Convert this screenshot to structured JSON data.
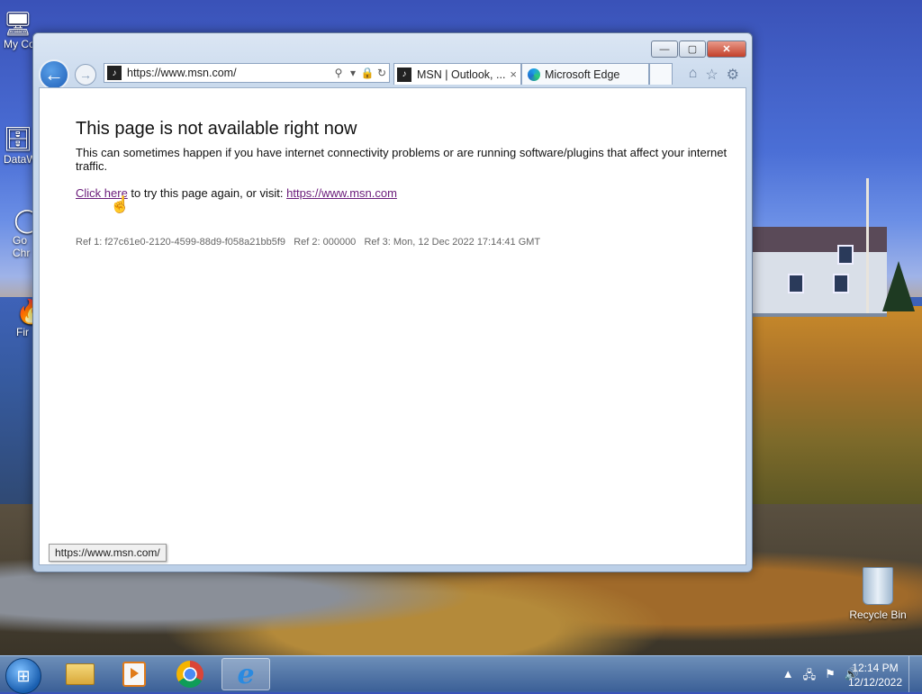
{
  "desktop": {
    "icons": [
      {
        "label": "My Co",
        "glyph": "🖥"
      },
      {
        "label": "DataW",
        "glyph": "🗄"
      },
      {
        "label": "Go Chr",
        "glyph": "◯"
      },
      {
        "label": "Fir",
        "glyph": "🔥"
      }
    ],
    "recycle_bin_label": "Recycle Bin"
  },
  "browser": {
    "address_url": "https://www.msn.com/",
    "tabs": [
      {
        "label": "MSN | Outlook, ...",
        "active": true,
        "close": "×"
      },
      {
        "label": "Microsoft Edge",
        "active": false
      }
    ],
    "caption": {
      "minimize": "—",
      "maximize": "▢",
      "close": "✕"
    }
  },
  "page": {
    "heading": "This page is not available right now",
    "paragraph": "This can sometimes happen if you have internet connectivity problems or are running software/plugins that affect your internet traffic.",
    "retry_link": "Click here",
    "retry_text": " to try this page again, or visit: ",
    "visit_link": "https://www.msn.com",
    "refs": "Ref 1: f27c61e0-2120-4599-88d9-f058a21bb5f9   Ref 2: 000000   Ref 3: Mon, 12 Dec 2022 17:14:41 GMT",
    "status_url": "https://www.msn.com/"
  },
  "taskbar": {
    "time": "12:14 PM",
    "date": "12/12/2022"
  },
  "colors": {
    "link": "#6a1b7a",
    "accent": "#1e5fb8"
  }
}
